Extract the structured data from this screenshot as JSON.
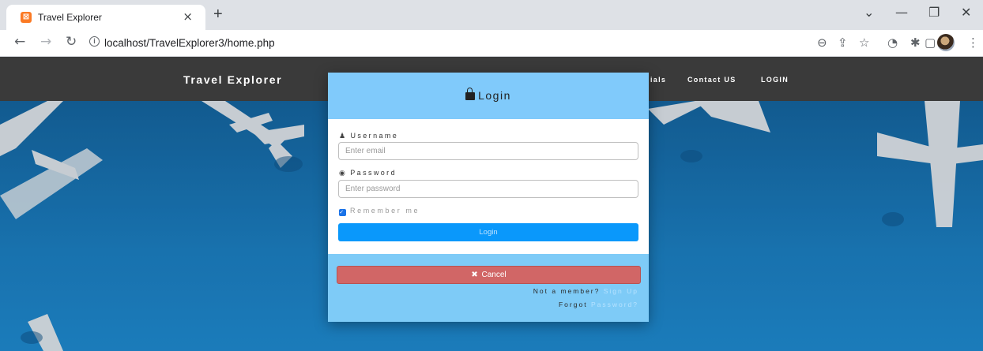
{
  "browser": {
    "tab_title": "Travel Explorer",
    "tab_close": "×",
    "new_tab": "+",
    "url": "localhost/TravelExplorer3/home.php",
    "controls": {
      "minimize": "—",
      "restore": "❐",
      "close": "✕",
      "tab_list": "⌄"
    }
  },
  "site": {
    "brand": "Travel Explorer",
    "nav": [
      "ials",
      "Contact US",
      "LOGIN"
    ]
  },
  "modal": {
    "title": "Login",
    "username_label": "Username",
    "username_placeholder": "Enter email",
    "password_label": "Password",
    "password_placeholder": "Enter password",
    "remember_label": "Remember me",
    "remember_checked": true,
    "login_button": "Login",
    "cancel_button": "Cancel",
    "not_member_text": "Not a member?",
    "sign_up_link": "Sign Up",
    "forgot_text": "Forgot",
    "password_link": "Password?"
  },
  "colors": {
    "modal_bg": "#7ecbf7",
    "login_button": "#0a98fb",
    "cancel_button": "#d16666",
    "navbar": "#3a3a3a",
    "hero": "#1b7fc2"
  }
}
